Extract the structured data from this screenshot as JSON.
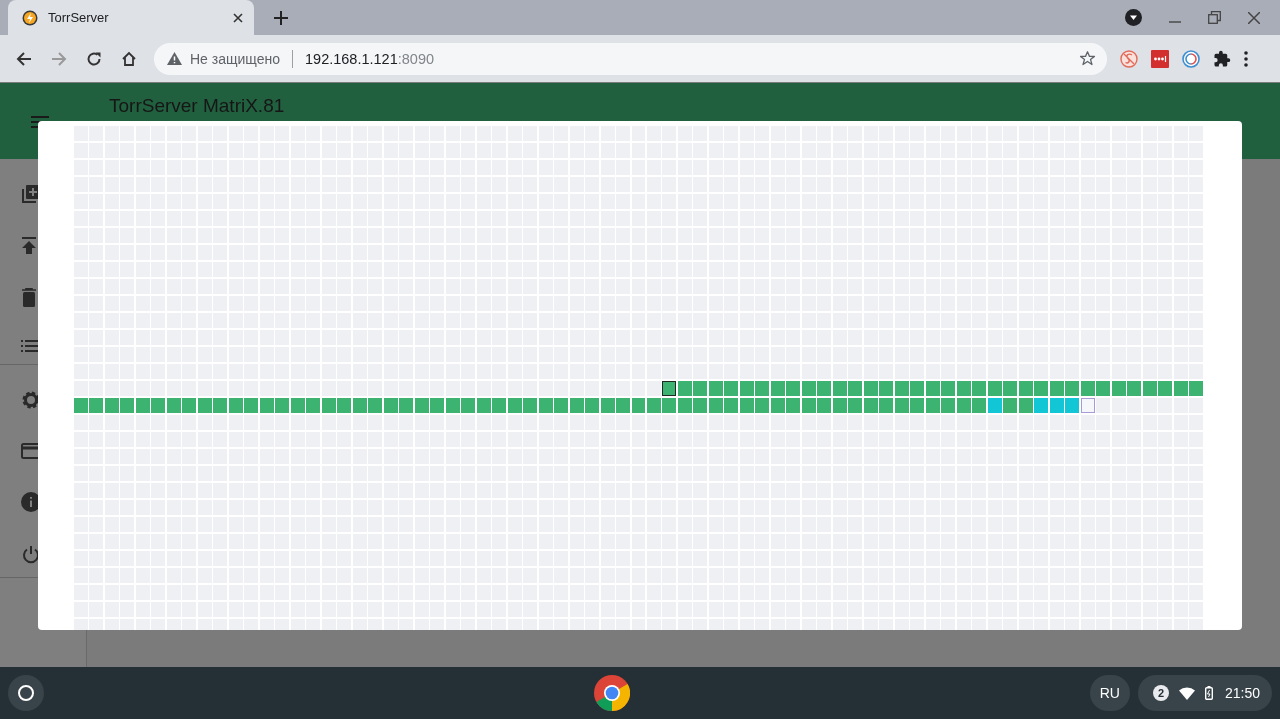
{
  "browser": {
    "tab": {
      "title": "TorrServer"
    },
    "address": {
      "security": "Не защищено",
      "host": "192.168.1.121",
      "port": ":8090"
    }
  },
  "app": {
    "title": "TorrServer MatriX.81"
  },
  "pieces": {
    "rows": [
      [
        {
          "kind": "empty",
          "outlined": false
        },
        {
          "kind": "empty",
          "outlined": false
        },
        {
          "kind": "empty",
          "outlined": false
        },
        {
          "kind": "empty",
          "outlined": false
        },
        {
          "kind": "empty",
          "outlined": false
        },
        {
          "kind": "empty",
          "outlined": false
        },
        {
          "kind": "empty",
          "outlined": false
        },
        {
          "kind": "empty",
          "outlined": false
        },
        {
          "kind": "empty",
          "outlined": false
        },
        {
          "kind": "empty",
          "outlined": false
        },
        {
          "kind": "empty",
          "outlined": false
        },
        {
          "kind": "empty",
          "outlined": false
        },
        {
          "kind": "empty",
          "outlined": false
        },
        {
          "kind": "empty",
          "outlined": false
        },
        {
          "kind": "empty",
          "outlined": false
        },
        {
          "kind": "empty",
          "outlined": false
        },
        {
          "kind": "empty",
          "outlined": false
        },
        {
          "kind": "empty",
          "outlined": false
        },
        {
          "kind": "empty",
          "outlined": false
        },
        {
          "kind": "empty",
          "outlined": false
        },
        {
          "kind": "empty",
          "outlined": false
        },
        {
          "kind": "empty",
          "outlined": false
        },
        {
          "kind": "empty",
          "outlined": false
        },
        {
          "kind": "empty",
          "outlined": false
        },
        {
          "kind": "empty",
          "outlined": false
        },
        {
          "kind": "empty",
          "outlined": false
        },
        {
          "kind": "empty",
          "outlined": false
        },
        {
          "kind": "empty",
          "outlined": false
        },
        {
          "kind": "empty",
          "outlined": false
        },
        {
          "kind": "empty",
          "outlined": false
        },
        {
          "kind": "empty",
          "outlined": false
        },
        {
          "kind": "empty",
          "outlined": false
        },
        {
          "kind": "empty",
          "outlined": false
        },
        {
          "kind": "empty",
          "outlined": false
        },
        {
          "kind": "empty",
          "outlined": false
        },
        {
          "kind": "empty",
          "outlined": false
        },
        {
          "kind": "empty",
          "outlined": false
        },
        {
          "kind": "empty",
          "outlined": false
        },
        {
          "kind": "done",
          "outlined": true
        },
        {
          "kind": "done",
          "outlined": false
        },
        {
          "kind": "done",
          "outlined": false
        },
        {
          "kind": "done",
          "outlined": false
        },
        {
          "kind": "done",
          "outlined": false
        },
        {
          "kind": "done",
          "outlined": false
        },
        {
          "kind": "done",
          "outlined": false
        },
        {
          "kind": "done",
          "outlined": false
        },
        {
          "kind": "done",
          "outlined": false
        },
        {
          "kind": "done",
          "outlined": false
        },
        {
          "kind": "done",
          "outlined": false
        },
        {
          "kind": "done",
          "outlined": false
        },
        {
          "kind": "done",
          "outlined": false
        },
        {
          "kind": "done",
          "outlined": false
        },
        {
          "kind": "done",
          "outlined": false
        },
        {
          "kind": "done",
          "outlined": false
        },
        {
          "kind": "done",
          "outlined": false
        },
        {
          "kind": "done",
          "outlined": false
        },
        {
          "kind": "done",
          "outlined": false
        },
        {
          "kind": "done",
          "outlined": false
        },
        {
          "kind": "done",
          "outlined": false
        },
        {
          "kind": "done",
          "outlined": false
        },
        {
          "kind": "done",
          "outlined": false
        },
        {
          "kind": "done",
          "outlined": false
        },
        {
          "kind": "done",
          "outlined": false
        },
        {
          "kind": "done",
          "outlined": false
        },
        {
          "kind": "done",
          "outlined": false
        },
        {
          "kind": "done",
          "outlined": false
        },
        {
          "kind": "done",
          "outlined": false
        },
        {
          "kind": "done",
          "outlined": false
        },
        {
          "kind": "done",
          "outlined": false
        },
        {
          "kind": "done",
          "outlined": false
        },
        {
          "kind": "done",
          "outlined": false
        },
        {
          "kind": "done",
          "outlined": false
        },
        {
          "kind": "done",
          "outlined": false
        }
      ],
      [
        {
          "kind": "done",
          "outlined": false
        },
        {
          "kind": "done",
          "outlined": false
        },
        {
          "kind": "done",
          "outlined": false
        },
        {
          "kind": "done",
          "outlined": false
        },
        {
          "kind": "done",
          "outlined": false
        },
        {
          "kind": "done",
          "outlined": false
        },
        {
          "kind": "done",
          "outlined": false
        },
        {
          "kind": "done",
          "outlined": false
        },
        {
          "kind": "done",
          "outlined": false
        },
        {
          "kind": "done",
          "outlined": false
        },
        {
          "kind": "done",
          "outlined": false
        },
        {
          "kind": "done",
          "outlined": false
        },
        {
          "kind": "done",
          "outlined": false
        },
        {
          "kind": "done",
          "outlined": false
        },
        {
          "kind": "done",
          "outlined": false
        },
        {
          "kind": "done",
          "outlined": false
        },
        {
          "kind": "done",
          "outlined": false
        },
        {
          "kind": "done",
          "outlined": false
        },
        {
          "kind": "done",
          "outlined": false
        },
        {
          "kind": "done",
          "outlined": false
        },
        {
          "kind": "done",
          "outlined": false
        },
        {
          "kind": "done",
          "outlined": false
        },
        {
          "kind": "done",
          "outlined": false
        },
        {
          "kind": "done",
          "outlined": false
        },
        {
          "kind": "done",
          "outlined": false
        },
        {
          "kind": "done",
          "outlined": false
        },
        {
          "kind": "done",
          "outlined": false
        },
        {
          "kind": "done",
          "outlined": false
        },
        {
          "kind": "done",
          "outlined": false
        },
        {
          "kind": "done",
          "outlined": false
        },
        {
          "kind": "done",
          "outlined": false
        },
        {
          "kind": "done",
          "outlined": false
        },
        {
          "kind": "done",
          "outlined": false
        },
        {
          "kind": "done",
          "outlined": false
        },
        {
          "kind": "done",
          "outlined": false
        },
        {
          "kind": "done",
          "outlined": false
        },
        {
          "kind": "done",
          "outlined": false
        },
        {
          "kind": "done",
          "outlined": false
        },
        {
          "kind": "done",
          "outlined": false
        },
        {
          "kind": "done",
          "outlined": false
        },
        {
          "kind": "done",
          "outlined": false
        },
        {
          "kind": "done",
          "outlined": false
        },
        {
          "kind": "done",
          "outlined": false
        },
        {
          "kind": "done",
          "outlined": false
        },
        {
          "kind": "done",
          "outlined": false
        },
        {
          "kind": "done",
          "outlined": false
        },
        {
          "kind": "done",
          "outlined": false
        },
        {
          "kind": "done",
          "outlined": false
        },
        {
          "kind": "done",
          "outlined": false
        },
        {
          "kind": "done",
          "outlined": false
        },
        {
          "kind": "done",
          "outlined": false
        },
        {
          "kind": "done",
          "outlined": false
        },
        {
          "kind": "done",
          "outlined": false
        },
        {
          "kind": "done",
          "outlined": false
        },
        {
          "kind": "done",
          "outlined": false
        },
        {
          "kind": "done",
          "outlined": false
        },
        {
          "kind": "done",
          "outlined": false
        },
        {
          "kind": "done",
          "outlined": false
        },
        {
          "kind": "done",
          "outlined": false
        },
        {
          "kind": "loading",
          "outlined": false
        },
        {
          "kind": "done",
          "outlined": false
        },
        {
          "kind": "done",
          "outlined": false
        },
        {
          "kind": "loading",
          "outlined": false
        },
        {
          "kind": "loading",
          "outlined": false
        },
        {
          "kind": "loading",
          "outlined": false
        },
        {
          "kind": "empty",
          "outlined": true
        },
        {
          "kind": "empty",
          "outlined": false
        },
        {
          "kind": "empty",
          "outlined": false
        },
        {
          "kind": "empty",
          "outlined": false
        },
        {
          "kind": "empty",
          "outlined": false
        },
        {
          "kind": "empty",
          "outlined": false
        },
        {
          "kind": "empty",
          "outlined": false
        },
        {
          "kind": "empty",
          "outlined": false
        }
      ]
    ]
  },
  "taskbar": {
    "language": "RU",
    "notifications": "2",
    "time": "21:50"
  }
}
